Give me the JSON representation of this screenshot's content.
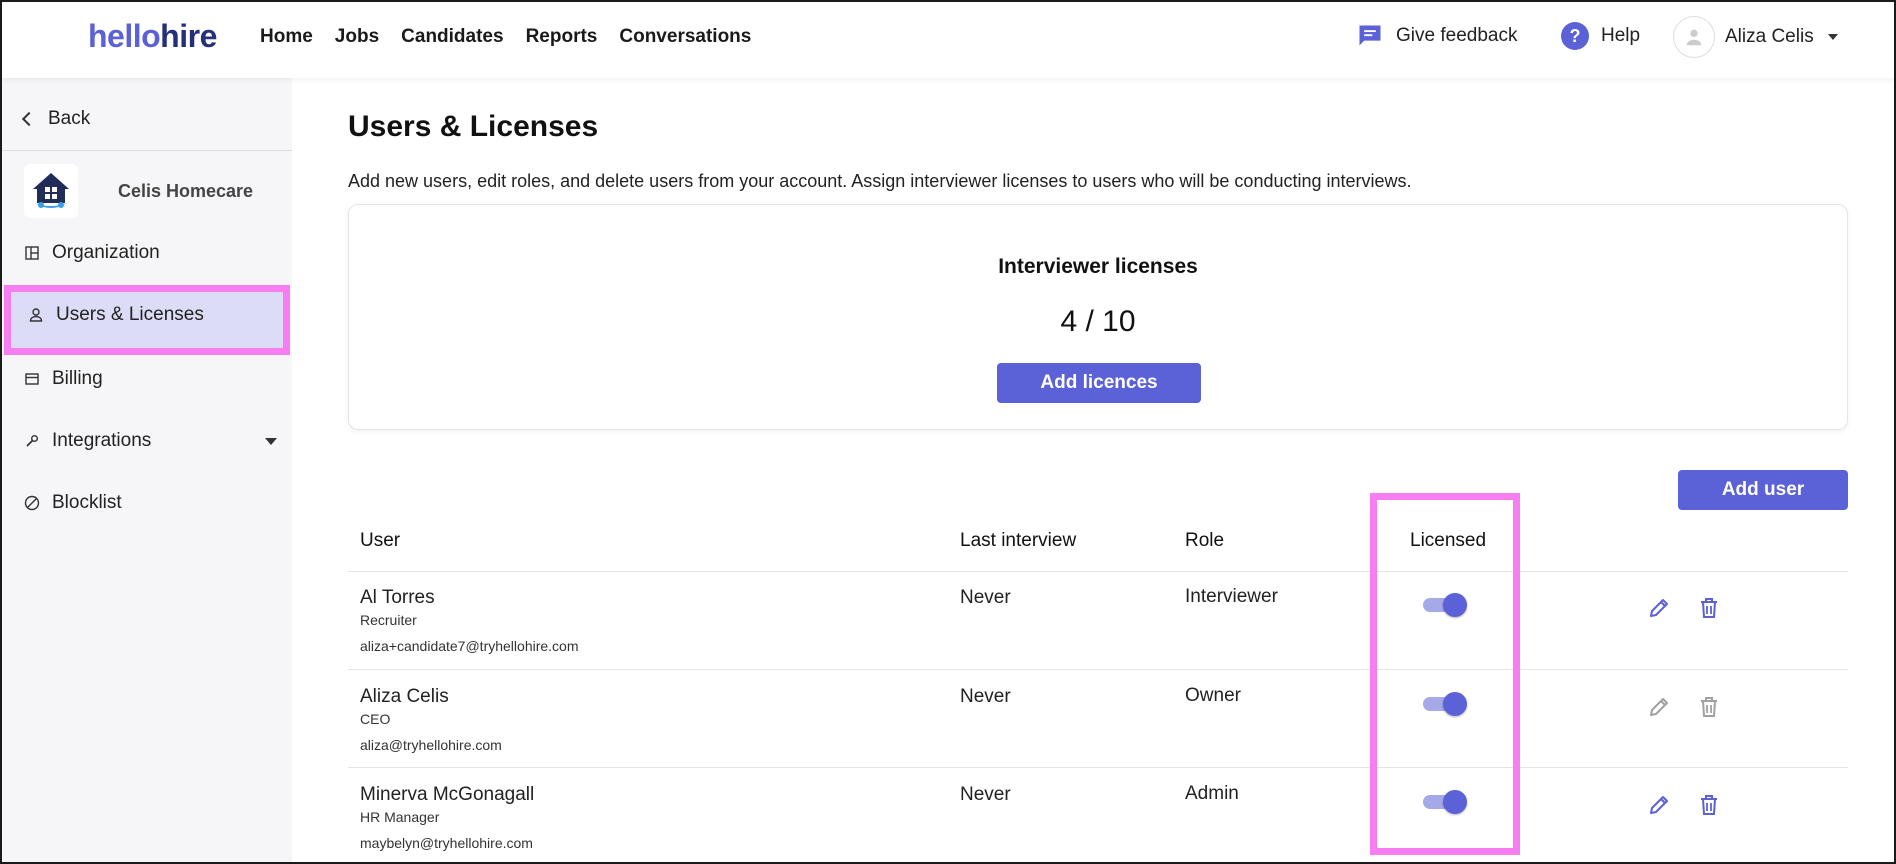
{
  "header": {
    "logo_part1": "hello",
    "logo_part2": "hire",
    "nav": [
      "Home",
      "Jobs",
      "Candidates",
      "Reports",
      "Conversations"
    ],
    "feedback_label": "Give feedback",
    "help_label": "Help",
    "user_name": "Aliza Celis"
  },
  "sidebar": {
    "back_label": "Back",
    "org_name": "Celis Homecare",
    "items": [
      {
        "label": "Organization",
        "icon": "layout-icon"
      },
      {
        "label": "Users & Licenses",
        "icon": "user-icon",
        "active": true
      },
      {
        "label": "Billing",
        "icon": "card-icon"
      },
      {
        "label": "Integrations",
        "icon": "wrench-icon"
      },
      {
        "label": "Blocklist",
        "icon": "block-icon"
      }
    ]
  },
  "main": {
    "title": "Users & Licenses",
    "description": "Add new users, edit roles, and delete users from your account. Assign interviewer licenses to users who will be conducting interviews.",
    "licenses": {
      "title": "Interviewer licenses",
      "count": "4 / 10",
      "button": "Add licences"
    },
    "add_user_button": "Add user",
    "table": {
      "headers": [
        "User",
        "Last interview",
        "Role",
        "Licensed"
      ],
      "rows": [
        {
          "name": "Al Torres",
          "title": "Recruiter",
          "email": "aliza+candidate7@tryhellohire.com",
          "last_interview": "Never",
          "role": "Interviewer",
          "licensed": true,
          "actions_enabled": true
        },
        {
          "name": "Aliza Celis",
          "title": "CEO",
          "email": "aliza@tryhellohire.com",
          "last_interview": "Never",
          "role": "Owner",
          "licensed": true,
          "actions_enabled": false
        },
        {
          "name": "Minerva McGonagall",
          "title": "HR Manager",
          "email": "maybelyn@tryhellohire.com",
          "last_interview": "Never",
          "role": "Admin",
          "licensed": true,
          "actions_enabled": true
        }
      ]
    }
  },
  "colors": {
    "accent": "#5b61d6",
    "highlight": "#f77ef0",
    "sidebar_active": "#dcdcf6"
  }
}
